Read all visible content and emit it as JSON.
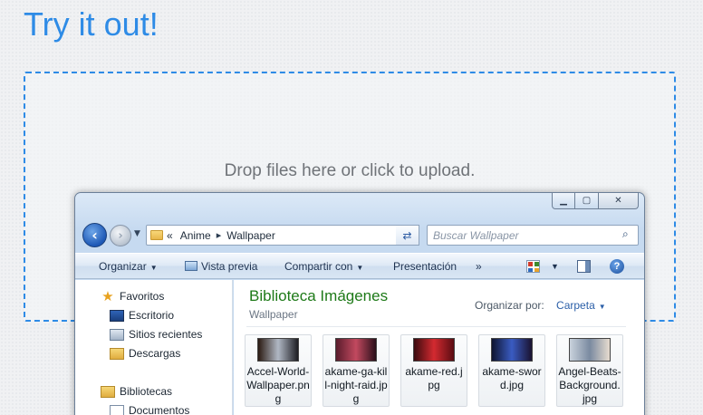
{
  "page": {
    "title": "Try it out!",
    "dropzone_message": "Drop files here or click to upload."
  },
  "window": {
    "caption_buttons": {
      "minimize": "▁",
      "maximize": "▢",
      "close": "✕"
    },
    "nav": {
      "back": "‹",
      "forward": "›"
    },
    "address": {
      "prefix": "«",
      "crumbs": [
        "Anime",
        "Wallpaper"
      ],
      "separator": "▸"
    },
    "search": {
      "placeholder": "Buscar Wallpaper"
    },
    "toolbar": {
      "organize": "Organizar",
      "preview": "Vista previa",
      "share": "Compartir con",
      "slideshow": "Presentación",
      "more": "»"
    },
    "nav_pane": {
      "items": [
        {
          "label": "Favoritos",
          "icon": "star-icon"
        },
        {
          "label": "Escritorio",
          "icon": "desktop-icon"
        },
        {
          "label": "Sitios recientes",
          "icon": "recent-places-icon"
        },
        {
          "label": "Descargas",
          "icon": "downloads-icon"
        },
        {
          "label": "Bibliotecas",
          "icon": "libraries-icon"
        },
        {
          "label": "Documentos",
          "icon": "documents-icon"
        }
      ]
    },
    "content": {
      "library_title": "Biblioteca Imágenes",
      "library_subtitle": "Wallpaper",
      "arrange_label": "Organizar por:",
      "arrange_value": "Carpeta",
      "files": [
        {
          "name": "Accel-World-Wallpaper.png",
          "colors": [
            "#2b1a12",
            "#b0b8c4",
            "#1c1c22"
          ]
        },
        {
          "name": "akame-ga-kill-night-raid.jpg",
          "colors": [
            "#5a1c2c",
            "#c2495f",
            "#2a0f1a"
          ]
        },
        {
          "name": "akame-red.jpg",
          "colors": [
            "#3a0a0e",
            "#d32a30",
            "#5a0c12"
          ]
        },
        {
          "name": "akame-sword.jpg",
          "colors": [
            "#0e1430",
            "#3a5cc2",
            "#1a1230"
          ]
        },
        {
          "name": "Angel-Beats-Background.jpg",
          "colors": [
            "#c9d2dc",
            "#7a8aa0",
            "#e7dccf"
          ]
        }
      ]
    }
  }
}
